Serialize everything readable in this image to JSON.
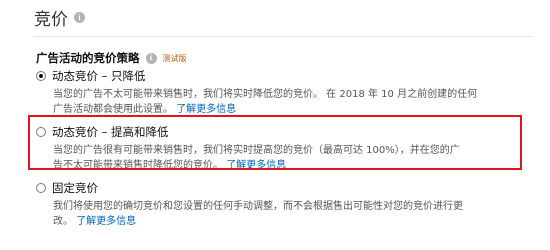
{
  "page": {
    "title": "竞价"
  },
  "strategy": {
    "title": "广告活动的竞价策略",
    "beta_label": "测试版"
  },
  "options": [
    {
      "label": "动态竞价 – 只降低",
      "selected": true,
      "desc_line1": "当您的广告不太可能带来销售时，我们将实时降低您的竞价。 在 2018 年 10 月之前创建的任何",
      "desc_line2": "广告活动都会使用此设置。",
      "link": "了解更多信息"
    },
    {
      "label": "动态竞价 – 提高和降低",
      "selected": false,
      "desc_line1": "当您的广告很有可能带来销售时，我们将实时提高您的竞价（最高可达 100%），并在您的广",
      "desc_line2": "告不太可能带来销售时降低您的竞价。",
      "link": "了解更多信息"
    },
    {
      "label": "固定竞价",
      "selected": false,
      "desc_line1": "我们将使用您的确切竞价和您设置的任何手动调整，而不会根据售出可能性对您的竞价进行更",
      "desc_line2": "改。",
      "link": "了解更多信息"
    }
  ],
  "colors": {
    "highlight": "#e3141b",
    "link": "#0066c0",
    "beta": "#c45500"
  }
}
